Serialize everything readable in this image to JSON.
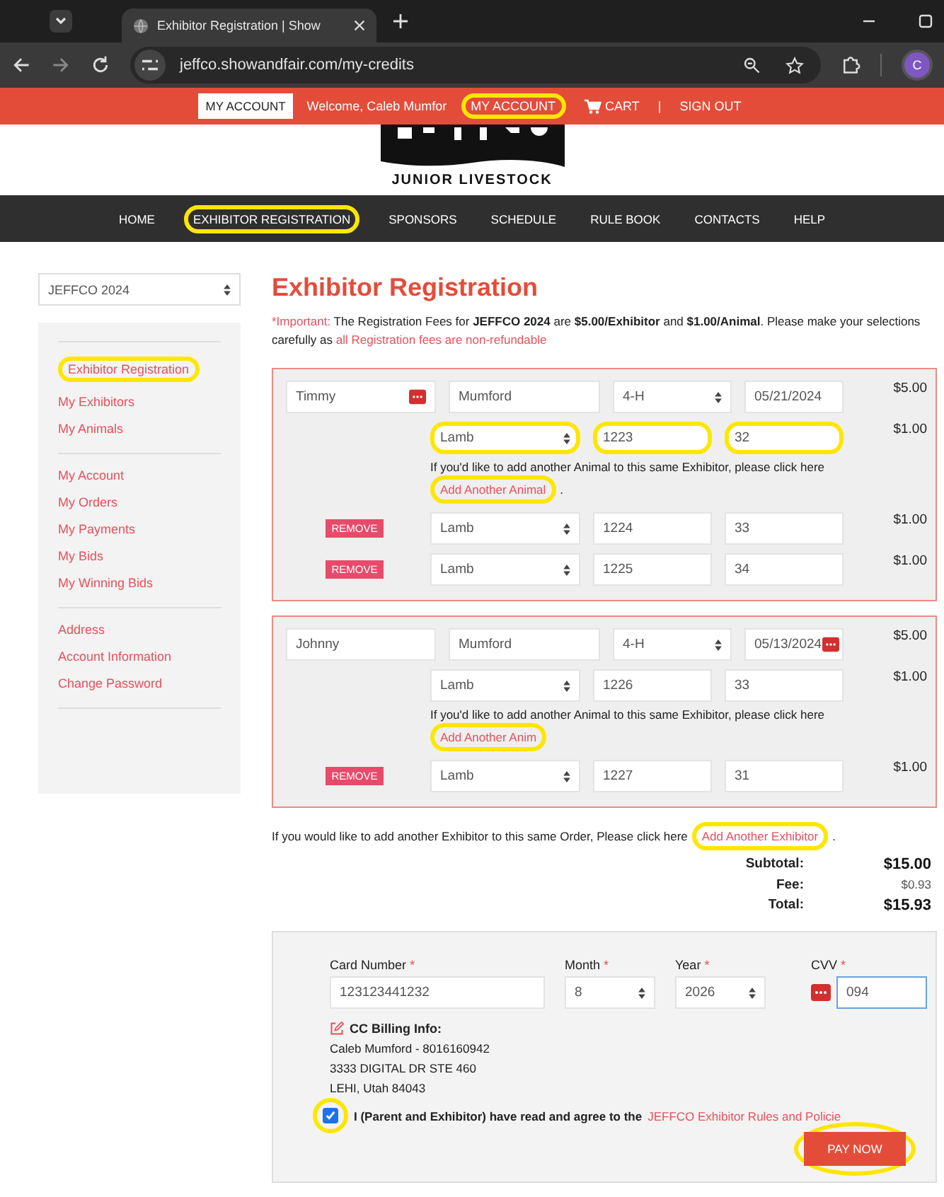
{
  "browser": {
    "tab_title": "Exhibitor Registration | Show",
    "url": "jeffco.showandfair.com/my-credits",
    "profile_initial": "C"
  },
  "top_bar": {
    "account_button": "MY ACCOUNT",
    "welcome": "Welcome, Caleb Mumfor",
    "links": [
      {
        "kind": "link",
        "label": "MY ACCOUNT",
        "annotated": true
      },
      {
        "kind": "cart",
        "label": "CART",
        "annotated": false
      },
      {
        "kind": "separator",
        "label": "|"
      },
      {
        "kind": "link",
        "label": "SIGN OUT",
        "annotated": false
      }
    ]
  },
  "logo": {
    "subtitle": "JUNIOR LIVESTOCK"
  },
  "nav": [
    {
      "label": "HOME",
      "annotated": false
    },
    {
      "label": "EXHIBITOR REGISTRATION",
      "annotated": true
    },
    {
      "label": "SPONSORS",
      "annotated": false
    },
    {
      "label": "SCHEDULE",
      "annotated": false
    },
    {
      "label": "RULE BOOK",
      "annotated": false
    },
    {
      "label": "CONTACTS",
      "annotated": false
    },
    {
      "label": "HELP",
      "annotated": false
    }
  ],
  "sidebar": {
    "event_select": "JEFFCO 2024",
    "groups": [
      [
        {
          "label": "Exhibitor Registration",
          "annotated": true
        },
        {
          "label": "My Exhibitors",
          "annotated": false
        },
        {
          "label": "My Animals",
          "annotated": false
        }
      ],
      [
        {
          "label": "My Account",
          "annotated": false
        },
        {
          "label": "My Orders",
          "annotated": false
        },
        {
          "label": "My Payments",
          "annotated": false
        },
        {
          "label": "My Bids",
          "annotated": false
        },
        {
          "label": "My Winning Bids",
          "annotated": false
        }
      ],
      [
        {
          "label": "Address",
          "annotated": false
        },
        {
          "label": "Account Information",
          "annotated": false
        },
        {
          "label": "Change Password",
          "annotated": false
        }
      ]
    ]
  },
  "title": "Exhibitor Registration",
  "notice": {
    "alert": "*Important:",
    "text": "The Registration Fees for **JEFFCO 2024** are **$5.00/Exhibitor** and **$1.00/Animal**. Please make your selections carefully as",
    "highlight": "all Registration fees are non-refundable"
  },
  "exhibitors": [
    {
      "first_name": "Timmy",
      "last_name": "Mumford",
      "club": "4-H",
      "date": "05/21/2024",
      "fee": "$5.00",
      "first_name_autofill": true,
      "date_autofill": false,
      "note": "If you'd like to add another Animal to this same Exhibitor, please click here",
      "add_link": "Add Another Animal",
      "note_end": ".",
      "link_annotated": true,
      "animals": [
        {
          "species": "Lamb",
          "tag": "1223",
          "weight": "32",
          "fee": "$1.00",
          "annotated": true
        },
        {
          "remove_button": "REMOVE",
          "species": "Lamb",
          "tag": "1224",
          "weight": "33",
          "fee": "$1.00",
          "annotated": false
        },
        {
          "remove_button": "REMOVE",
          "species": "Lamb",
          "tag": "1225",
          "weight": "34",
          "fee": "$1.00",
          "annotated": false
        }
      ]
    },
    {
      "first_name": "Johnny",
      "last_name": "Mumford",
      "club": "4-H",
      "date": "05/13/2024",
      "fee": "$5.00",
      "first_name_autofill": false,
      "date_autofill": true,
      "note": "If you'd like to add another Animal to this same Exhibitor, please click here",
      "add_link": "Add Another Anim",
      "link_annotated": true,
      "animals": [
        {
          "species": "Lamb",
          "tag": "1226",
          "weight": "33",
          "fee": "$1.00",
          "annotated": false
        },
        {
          "remove_button": "REMOVE",
          "species": "Lamb",
          "tag": "1227",
          "weight": "31",
          "fee": "$1.00",
          "annotated": false
        }
      ]
    }
  ],
  "add_exhibitor": {
    "text": "If you would like to add another Exhibitor to this same Order, Please click here",
    "link": "Add Another Exhibitor",
    "end": ".",
    "annotated": true
  },
  "totals": [
    {
      "label": "Subtotal:",
      "value": "$15.00",
      "emphasis": true
    },
    {
      "label": "Fee:",
      "value": "$0.93",
      "emphasis": false
    },
    {
      "label": "Total:",
      "value": "$15.93",
      "emphasis": true
    }
  ],
  "payment": {
    "fields": [
      {
        "label": "Card Number",
        "required_mark": "*",
        "kind": "text",
        "value": "123123441232",
        "focused": false,
        "autofill_icon": false
      },
      {
        "label": "Month",
        "required_mark": "*",
        "kind": "select",
        "value": "8",
        "focused": false,
        "autofill_icon": false
      },
      {
        "label": "Year",
        "required_mark": "*",
        "kind": "select",
        "value": "2026",
        "focused": false,
        "autofill_icon": false
      },
      {
        "label": "CVV",
        "required_mark": "*",
        "kind": "text",
        "value": "094",
        "focused": true,
        "autofill_icon": true
      }
    ],
    "billing_title": "CC Billing Info:",
    "billing_lines": [
      "Caleb Mumford - 8016160942",
      "3333 DIGITAL DR STE 460",
      "LEHI, Utah 84043"
    ],
    "agree": {
      "checked": true,
      "annotated": true,
      "text": "I (Parent and Exhibitor) have read and agree to the",
      "link": "JEFFCO Exhibitor Rules and Policie"
    },
    "pay_button": {
      "label": "PAY NOW",
      "annotated": true
    }
  }
}
